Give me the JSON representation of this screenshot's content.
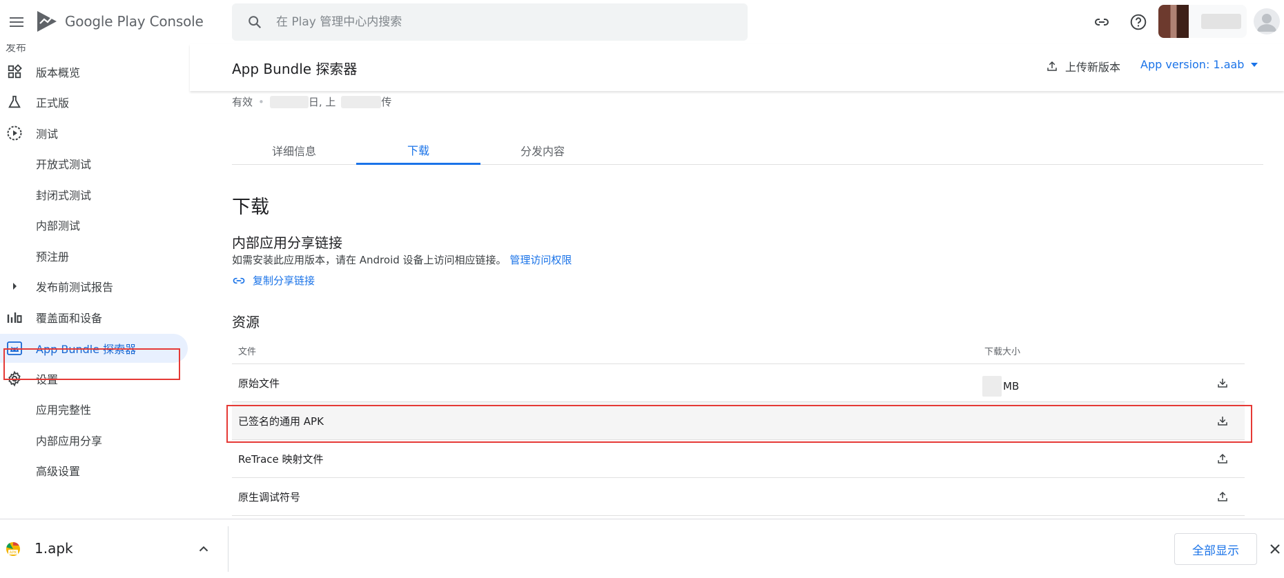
{
  "topbar": {
    "logo_text_main": "Google Play",
    "logo_text_sub": "Console",
    "search_placeholder": "在 Play 管理中心内搜索"
  },
  "sidebar": {
    "section_label_cut": "发布",
    "items": [
      {
        "label": "版本概览",
        "icon": "dashboard-icon"
      },
      {
        "label": "正式版",
        "icon": "flask-icon"
      },
      {
        "label": "测试",
        "icon": "play-circle-icon"
      },
      {
        "label": "开放式测试"
      },
      {
        "label": "封闭式测试"
      },
      {
        "label": "内部测试"
      },
      {
        "label": "预注册"
      },
      {
        "label": "发布前测试报告",
        "icon": "expand-arrow-icon"
      },
      {
        "label": "覆盖面和设备",
        "icon": "bar-chart-icon"
      },
      {
        "label": "App Bundle 探索器",
        "icon": "android-icon",
        "active": true
      },
      {
        "label": "设置",
        "icon": "gear-icon"
      },
      {
        "label": "应用完整性"
      },
      {
        "label": "内部应用分享"
      },
      {
        "label": "高级设置"
      }
    ]
  },
  "header": {
    "title": "App Bundle 探索器",
    "upload_label": "上传新版本",
    "version_label": "App version: 1.aab"
  },
  "status": {
    "state": "有效",
    "text_fragment_1": "日, 上",
    "text_fragment_2": "传"
  },
  "tabs": [
    {
      "label": "详细信息"
    },
    {
      "label": "下载",
      "active": true
    },
    {
      "label": "分发内容"
    }
  ],
  "download": {
    "heading": "下载",
    "share_heading": "内部应用分享链接",
    "share_desc": "如需安装此应用版本，请在 Android 设备上访问相应链接。",
    "manage_access": "管理访问权限",
    "copy_link": "复制分享链接",
    "resources_heading": "资源",
    "table": {
      "col_file": "文件",
      "col_size": "下载大小",
      "rows": [
        {
          "name": "原始文件",
          "size": "MB",
          "action": "download-icon"
        },
        {
          "name": "已签名的通用 APK",
          "size": "",
          "action": "download-icon"
        },
        {
          "name": "ReTrace 映射文件",
          "size": "",
          "action": "upload-icon"
        },
        {
          "name": "原生调试符号",
          "size": "",
          "action": "upload-icon"
        }
      ]
    }
  },
  "shelf": {
    "file_name": "1.apk",
    "show_all": "全部显示"
  },
  "colors": {
    "accent": "#1a73e8",
    "highlight_box": "#e53935",
    "active_nav_bg": "#e8f0fe"
  }
}
